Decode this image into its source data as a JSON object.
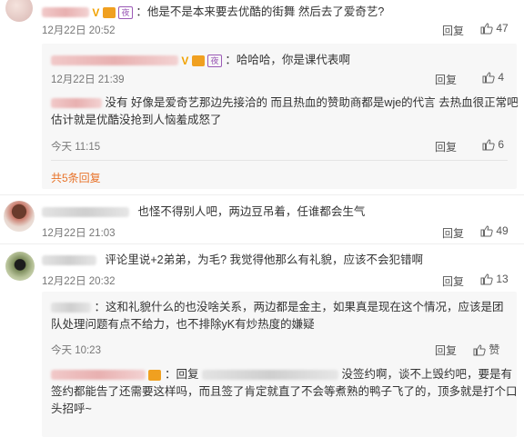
{
  "comments": [
    {
      "text": "：他是不是本来要去优酷的街舞 然后去了爱奇艺?",
      "time": "12月22日 20:52",
      "reply_label": "回复",
      "likes": "47",
      "badge_ye": "夜",
      "replies": [
        {
          "text": "：哈哈哈，你是课代表啊",
          "time": "12月22日 21:39",
          "reply_label": "回复",
          "likes": "4",
          "badge_ye": "夜"
        },
        {
          "text_line1": "没有 好像是爱奇艺那边先接洽的 而且热血的赞助商都是wje的代言 去热血很正常吧",
          "text_line2": "估计就是优酷没抢到人恼羞成怒了",
          "time": "今天 11:15",
          "reply_label": "回复",
          "likes": "6"
        }
      ],
      "more_replies": "共5条回复"
    },
    {
      "text": "也怪不得别人吧，两边豆吊着，任谁都会生气",
      "time": "12月22日 21:03",
      "reply_label": "回复",
      "likes": "49"
    },
    {
      "text": "评论里说+2弟弟，为毛? 我觉得他那么有礼貌，应该不会犯错啊",
      "time": "12月22日 20:32",
      "reply_label": "回复",
      "likes": "13",
      "replies": [
        {
          "text_line1": "：这和礼貌什么的也没啥关系，两边都是金主，如果真是现在这个情况，应该是团",
          "text_line2": "队处理问题有点不给力，也不排除yK有炒热度的嫌疑",
          "time": "今天 10:23",
          "reply_label": "回复",
          "likes": "赞"
        },
        {
          "text_a": "：回复",
          "text_b": "没签约啊，谈不上毁约吧，要是有",
          "text_line2": "签约都能告了还需要这样吗，而且签了肯定就直了不会等煮熟的鸭子飞了的，顶多就是打个口",
          "text_line3": "头招呼~"
        }
      ]
    }
  ]
}
